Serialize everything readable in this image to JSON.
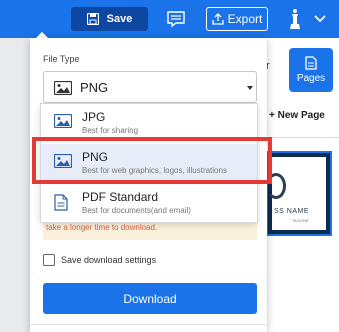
{
  "topbar": {
    "save_label": "Save",
    "export_label": "Export",
    "icons": [
      "save-icon",
      "comment-icon",
      "export-icon",
      "avatar-icon",
      "chevron-down-icon"
    ]
  },
  "background_panel": {
    "partial_label": "r",
    "pages_label": "Pages",
    "new_page_label": "+ New Page",
    "thumbnail_text": "SS NAME",
    "thumbnail_subtext": "TAGLINE"
  },
  "file_type": {
    "label": "File Type",
    "selected": "PNG",
    "options": [
      {
        "title": "JPG",
        "desc": "Best for sharing",
        "icon": "image-icon"
      },
      {
        "title": "PNG",
        "desc": "Best for web graphics, logos, illustrations",
        "icon": "image-icon"
      },
      {
        "title": "PDF Standard",
        "desc": "Best for documents(and email)",
        "icon": "document-icon"
      }
    ]
  },
  "warning_text": "take a longer time to download.",
  "save_settings_label": "Save download settings",
  "download_label": "Download",
  "colors": {
    "primary": "#1a73e8",
    "save_button": "#0d47a1",
    "highlight": "#e53935",
    "warning_bg": "#fbf0dc",
    "warning_text": "#d9603d"
  }
}
